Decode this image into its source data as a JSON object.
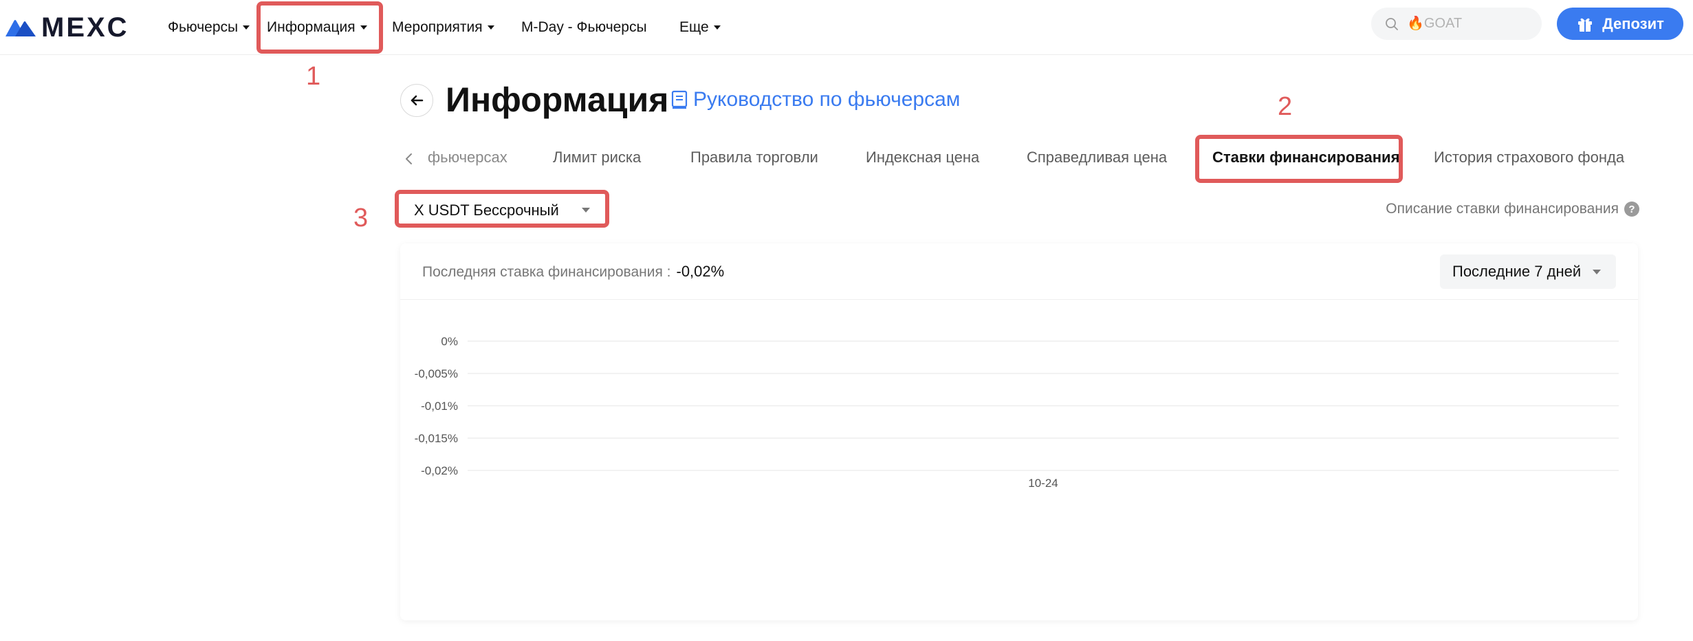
{
  "brand": {
    "logo_text": "MEXC"
  },
  "nav": {
    "items": [
      {
        "label": "Фьючерсы",
        "has_dropdown": true
      },
      {
        "label": "Информация",
        "has_dropdown": true
      },
      {
        "label": "Мероприятия",
        "has_dropdown": true
      },
      {
        "label": "M-Day - Фьючерсы",
        "has_dropdown": false
      },
      {
        "label": "Еще",
        "has_dropdown": true
      }
    ]
  },
  "search": {
    "placeholder": "🔥GOAT",
    "value": ""
  },
  "deposit": {
    "label": "Депозит"
  },
  "annotations": [
    "1",
    "2",
    "3"
  ],
  "page": {
    "title": "Информация",
    "guide_link": "Руководство по фьючерсам"
  },
  "tabs": [
    {
      "label": "фьючерсах",
      "active": false
    },
    {
      "label": "Лимит риска",
      "active": false
    },
    {
      "label": "Правила торговли",
      "active": false
    },
    {
      "label": "Индексная цена",
      "active": false
    },
    {
      "label": "Справедливая цена",
      "active": false
    },
    {
      "label": "Ставки финансирования",
      "active": true
    },
    {
      "label": "История страхового фонда",
      "active": false
    }
  ],
  "contract": {
    "selected": "X USDT Бессрочный"
  },
  "description_link": "Описание ставки финансирования",
  "card": {
    "last_rate_label": "Последняя ставка финансирования :",
    "last_rate_value": "-0,02%",
    "range_selected": "Последние 7 дней"
  },
  "chart_data": {
    "type": "line",
    "title": "",
    "xlabel": "",
    "ylabel": "",
    "y_tick_labels": [
      "0%",
      "-0,005%",
      "-0,01%",
      "-0,015%",
      "-0,02%"
    ],
    "y_ticks": [
      0,
      -0.005,
      -0.01,
      -0.015,
      -0.02
    ],
    "ylim": [
      -0.02,
      0
    ],
    "x_tick_labels": [
      "10-24"
    ],
    "grid": true,
    "series": []
  },
  "colors": {
    "accent": "#3a7bf0",
    "annotation": "#e05a5a",
    "text_primary": "#121212",
    "text_secondary": "#767676"
  }
}
